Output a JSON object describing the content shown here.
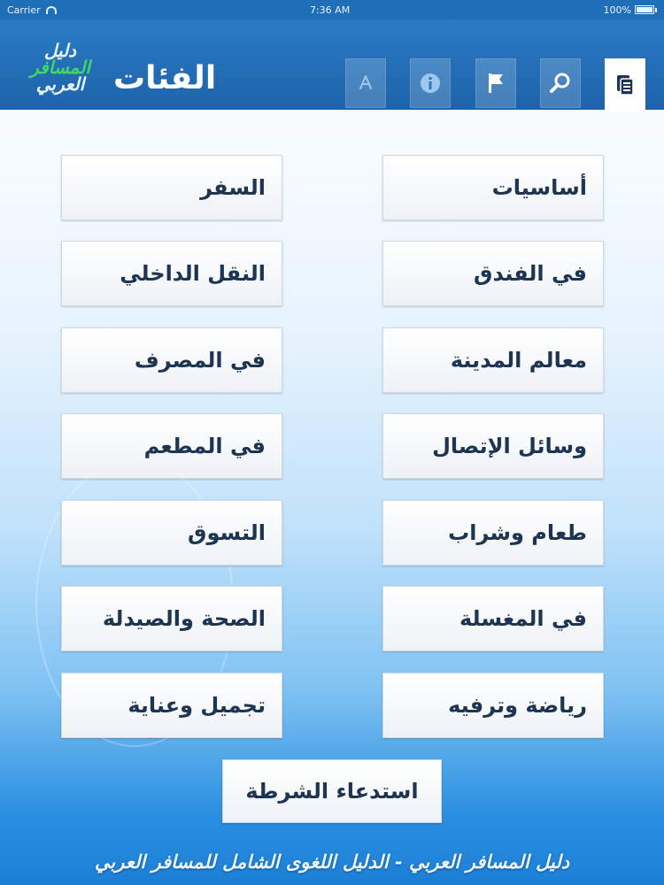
{
  "status_bar": {
    "carrier": "Carrier",
    "time": "7:36 AM",
    "battery_text": "100%",
    "battery_level": 1.0
  },
  "header": {
    "brand": {
      "line1": "دليل",
      "line2": "المسافر",
      "line3": "العربي"
    },
    "title": "الفئات",
    "tabs": [
      {
        "name": "categories",
        "icon": "document-list-icon",
        "active": true
      },
      {
        "name": "search",
        "icon": "search-icon",
        "active": false
      },
      {
        "name": "flag",
        "icon": "flag-icon",
        "active": false
      },
      {
        "name": "info",
        "icon": "info-icon",
        "active": false
      },
      {
        "name": "app-store",
        "icon": "app-store-icon",
        "active": false
      }
    ]
  },
  "categories": {
    "right": [
      "أساسيات",
      "في الفندق",
      "معالم المدينة",
      "وسائل الإتصال",
      "طعام وشراب",
      "في المغسلة",
      "رياضة وترفيه"
    ],
    "left": [
      "السفر",
      "النقل الداخلي",
      "في المصرف",
      "في المطعم",
      "التسوق",
      "الصحة والصيدلة",
      "تجميل وعناية"
    ]
  },
  "police_button": "استدعاء الشرطة",
  "footer": "دليل المسافر العربي - الدليل اللغوى الشامل للمسافر العربي",
  "colors": {
    "header": "#1d63aa",
    "accent_green": "#42d663",
    "button_text": "#1d3552"
  }
}
